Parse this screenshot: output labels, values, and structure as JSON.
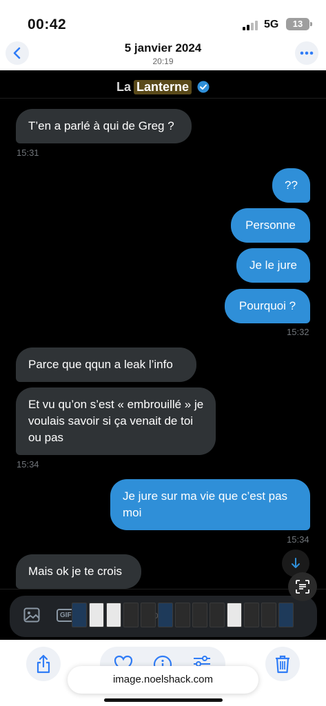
{
  "status_bar": {
    "time": "00:42",
    "network": "5G",
    "battery": "13"
  },
  "photo_header": {
    "date": "5 janvier 2024",
    "time": "20:19"
  },
  "chat": {
    "title_part1": "La",
    "title_part2": "Lanterne",
    "messages": [
      {
        "text": "T’en a parlé à qui de Greg ?",
        "direction": "in"
      },
      {
        "text": "??",
        "direction": "out"
      },
      {
        "text": "Personne",
        "direction": "out"
      },
      {
        "text": "Je le jure",
        "direction": "out"
      },
      {
        "text": "Pourquoi ?",
        "direction": "out"
      },
      {
        "text": "Parce que qqun a leak l’info",
        "direction": "in"
      },
      {
        "text": "Et vu qu’on s’est « embrouillé » je voulais savoir si ça venait de toi ou pas",
        "direction": "in"
      },
      {
        "text": "Je jure sur ma vie que c’est pas moi",
        "direction": "out"
      },
      {
        "text": "Mais ok je te crois",
        "direction": "in"
      }
    ],
    "timestamps": [
      "15:31",
      "15:32",
      "15:34",
      "15:34"
    ],
    "composer": {
      "gif_label": "GIF",
      "placeholder": "co"
    }
  },
  "browser": {
    "url": "image.noelshack.com"
  },
  "colors": {
    "outgoing_bubble": "#2f8fd8",
    "incoming_bubble": "#2f3336",
    "chat_background": "#000000",
    "ios_accent": "#2f7cf6"
  },
  "icons": [
    "back-icon",
    "more-icon",
    "verified-icon",
    "arrow-down-icon",
    "live-text-icon",
    "gallery-icon",
    "share-icon",
    "heart-icon",
    "info-icon",
    "adjust-icon",
    "trash-icon"
  ]
}
